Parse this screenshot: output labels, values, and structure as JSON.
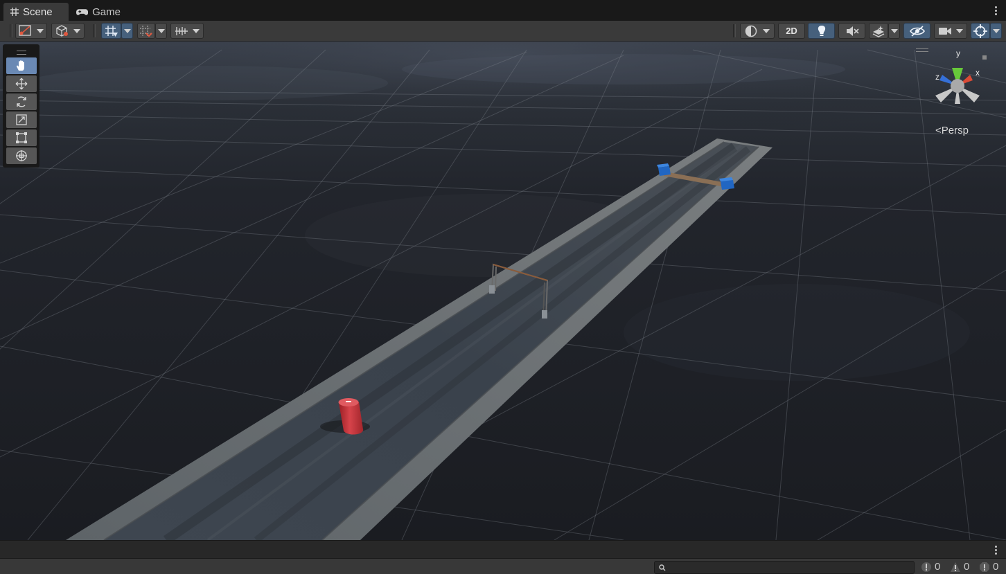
{
  "tabs": [
    {
      "label": "Scene",
      "icon": "grid-icon"
    },
    {
      "label": "Game",
      "icon": "gamepad-icon"
    }
  ],
  "toolbar": {
    "twod_label": "2D"
  },
  "viewport": {
    "projection_label": "Persp",
    "axes": {
      "x": "x",
      "y": "y",
      "z": "z"
    }
  },
  "console": {
    "search_placeholder": "",
    "log_count": "0",
    "warning_count": "0",
    "error_count": "0"
  },
  "colors": {
    "accent": "#46607c",
    "active_tool": "#6a89b4",
    "cylinder": "#c8343a",
    "blocks": "#2166c2"
  }
}
